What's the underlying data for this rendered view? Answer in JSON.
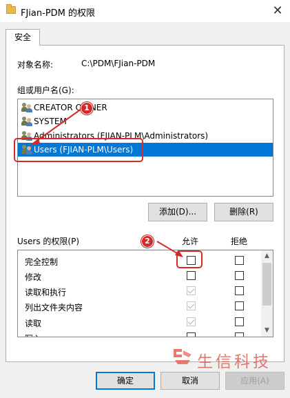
{
  "window": {
    "title": "FJian-PDM 的权限",
    "close_glyph": "✕"
  },
  "tab": {
    "label": "安全"
  },
  "object": {
    "label": "对象名称:",
    "value": "C:\\PDM\\FJian-PDM"
  },
  "groups": {
    "label": "组或用户名(G):",
    "items": [
      {
        "label": "CREATOR OWNER",
        "icon": "users-icon"
      },
      {
        "label": "SYSTEM",
        "icon": "users-icon"
      },
      {
        "label": "Administrators (FJIAN-PLM\\Administrators)",
        "icon": "users-icon"
      },
      {
        "label": "Users (FJIAN-PLM\\Users)",
        "icon": "users-icon",
        "selected": true
      }
    ]
  },
  "actions": {
    "add_label": "添加(D)...",
    "remove_label": "删除(R)"
  },
  "permissions": {
    "label": "Users 的权限(P)",
    "allow_header": "允许",
    "deny_header": "拒绝",
    "rows": [
      {
        "name": "完全控制",
        "allow": "unchecked",
        "deny": "unchecked"
      },
      {
        "name": "修改",
        "allow": "unchecked",
        "deny": "unchecked"
      },
      {
        "name": "读取和执行",
        "allow": "checked-disabled",
        "deny": "unchecked"
      },
      {
        "name": "列出文件夹内容",
        "allow": "checked-disabled",
        "deny": "unchecked"
      },
      {
        "name": "读取",
        "allow": "checked-disabled",
        "deny": "unchecked"
      },
      {
        "name": "写入",
        "allow": "unchecked",
        "deny": "unchecked"
      }
    ]
  },
  "footer": {
    "ok_label": "确定",
    "cancel_label": "取消",
    "apply_label": "应用(A)"
  },
  "annotations": {
    "badge1": "1",
    "badge2": "2",
    "color": "#d62a2a"
  },
  "watermark": {
    "text": "生信科技"
  }
}
